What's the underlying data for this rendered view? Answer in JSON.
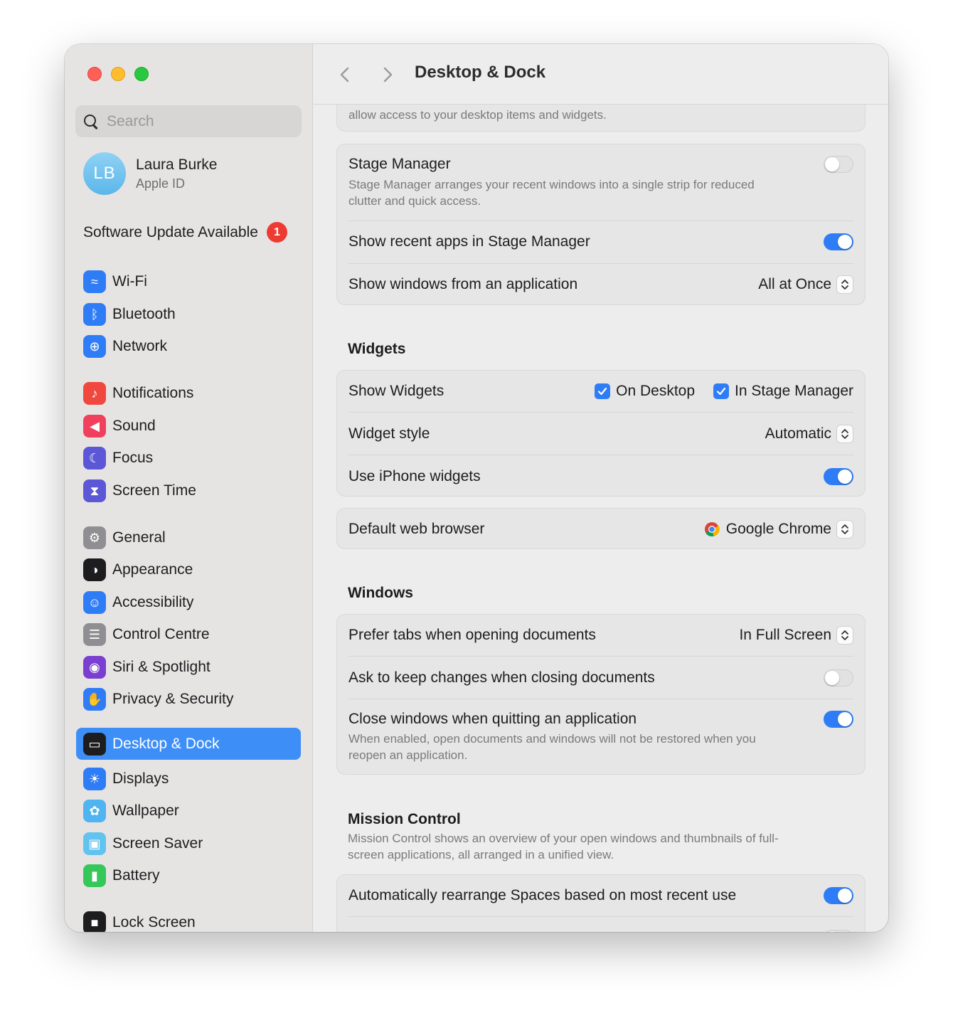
{
  "window": {
    "title": "Desktop & Dock"
  },
  "search": {
    "placeholder": "Search"
  },
  "account": {
    "initials": "LB",
    "name": "Laura Burke",
    "subtitle": "Apple ID"
  },
  "update": {
    "label": "Software Update Available",
    "count": "1"
  },
  "sidebar": {
    "items": [
      {
        "label": "Wi-Fi",
        "icon": "wifi-icon",
        "color": "#2f7df6"
      },
      {
        "label": "Bluetooth",
        "icon": "bluetooth-icon",
        "color": "#2f7df6"
      },
      {
        "label": "Network",
        "icon": "globe-icon",
        "color": "#2f7df6"
      },
      {
        "label": "Notifications",
        "icon": "bell-icon",
        "color": "#f0473e"
      },
      {
        "label": "Sound",
        "icon": "speaker-icon",
        "color": "#f0405e"
      },
      {
        "label": "Focus",
        "icon": "moon-icon",
        "color": "#5b57d6"
      },
      {
        "label": "Screen Time",
        "icon": "hourglass-icon",
        "color": "#5b57d6"
      },
      {
        "label": "General",
        "icon": "gear-icon",
        "color": "#8e8e93"
      },
      {
        "label": "Appearance",
        "icon": "appearance-icon",
        "color": "#1d1d1f"
      },
      {
        "label": "Accessibility",
        "icon": "accessibility-icon",
        "color": "#2f7df6"
      },
      {
        "label": "Control Centre",
        "icon": "switches-icon",
        "color": "#8e8e93"
      },
      {
        "label": "Siri & Spotlight",
        "icon": "siri-icon",
        "color": "#7a3fd0"
      },
      {
        "label": "Privacy & Security",
        "icon": "hand-icon",
        "color": "#2f7df6"
      },
      {
        "label": "Desktop & Dock",
        "icon": "dock-icon",
        "color": "#1d1d1f"
      },
      {
        "label": "Displays",
        "icon": "sun-icon",
        "color": "#2f7df6"
      },
      {
        "label": "Wallpaper",
        "icon": "flower-icon",
        "color": "#4fb4f0"
      },
      {
        "label": "Screen Saver",
        "icon": "screensaver-icon",
        "color": "#62c3ef"
      },
      {
        "label": "Battery",
        "icon": "battery-icon",
        "color": "#35c759"
      },
      {
        "label": "Lock Screen",
        "icon": "lock-icon",
        "color": "#1d1d1f"
      }
    ]
  },
  "top_card": {
    "desc": "allow access to your desktop items and widgets."
  },
  "stage": {
    "title": "Stage Manager",
    "desc1": "Stage Manager arranges your recent windows into a single strip for reduced",
    "desc2": "clutter and quick access.",
    "enabled": false,
    "recent_label": "Show recent apps in Stage Manager",
    "recent_on": true,
    "windows_label": "Show windows from an application",
    "windows_value": "All at Once"
  },
  "widgets": {
    "heading": "Widgets",
    "show_label": "Show Widgets",
    "on_desktop": "On Desktop",
    "in_stage": "In Stage Manager",
    "style_label": "Widget style",
    "style_value": "Automatic",
    "iphone_label": "Use iPhone widgets",
    "iphone_on": true
  },
  "browser": {
    "label": "Default web browser",
    "value": "Google Chrome"
  },
  "windows": {
    "heading": "Windows",
    "tabs_label": "Prefer tabs when opening documents",
    "tabs_value": "In Full Screen",
    "ask_label": "Ask to keep changes when closing documents",
    "ask_on": false,
    "close_label": "Close windows when quitting an application",
    "close_on": true,
    "close_desc1": "When enabled, open documents and windows will not be restored when you",
    "close_desc2": "reopen an application."
  },
  "mission": {
    "heading": "Mission Control",
    "desc1": "Mission Control shows an overview of your open windows and thumbnails of full-",
    "desc2": "screen applications, all arranged in a unified view.",
    "rearrange_label": "Automatically rearrange Spaces based on most recent use",
    "rearrange_on": true
  },
  "colors": {
    "accent": "#2f7df6",
    "selection": "#3e8ef8",
    "badge": "#ee3b32"
  }
}
